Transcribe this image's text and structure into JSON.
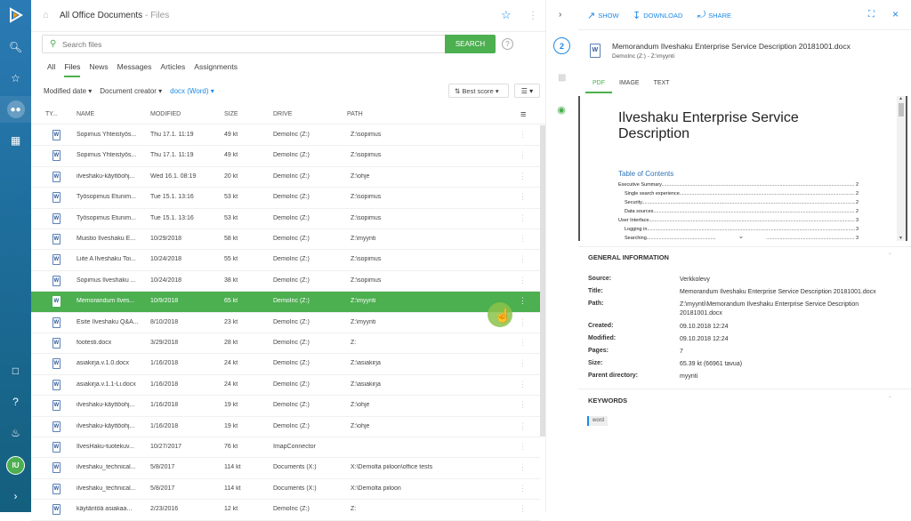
{
  "header": {
    "title": "All Office Documents",
    "subtitle": "- Files"
  },
  "search": {
    "placeholder": "Search files",
    "button": "SEARCH"
  },
  "tabs": [
    "All",
    "Files",
    "News",
    "Messages",
    "Articles",
    "Assignments"
  ],
  "filters": {
    "modified": "Modified date",
    "creator": "Document creator",
    "type": "docx (Word)",
    "sort": "Best score"
  },
  "columns": {
    "type": "TY...",
    "name": "NAME",
    "modified": "MODIFIED",
    "size": "SIZE",
    "drive": "DRIVE",
    "path": "PATH"
  },
  "rows": [
    {
      "name": "Sopimus Yhteistyös...",
      "modified": "Thu 17.1. 11:19",
      "size": "49 kt",
      "drive": "DemoInc (Z:)",
      "path": "Z:\\sopimus"
    },
    {
      "name": "Sopimus Yhteistyös...",
      "modified": "Thu 17.1. 11:19",
      "size": "49 kt",
      "drive": "DemoInc (Z:)",
      "path": "Z:\\sopimus"
    },
    {
      "name": "ilveshaku-käyttöohj...",
      "modified": "Wed 16.1. 08:19",
      "size": "20 kt",
      "drive": "DemoInc (Z:)",
      "path": "Z:\\ohje"
    },
    {
      "name": "Työsopimus Etunim...",
      "modified": "Tue 15.1. 13:16",
      "size": "53 kt",
      "drive": "DemoInc (Z:)",
      "path": "Z:\\sopimus"
    },
    {
      "name": "Työsopimus Etunim...",
      "modified": "Tue 15.1. 13:16",
      "size": "53 kt",
      "drive": "DemoInc (Z:)",
      "path": "Z:\\sopimus"
    },
    {
      "name": "Muistio Ilveshaku E...",
      "modified": "10/29/2018",
      "size": "58 kt",
      "drive": "DemoInc (Z:)",
      "path": "Z:\\myynti"
    },
    {
      "name": "Liite A Ilveshaku Toi...",
      "modified": "10/24/2018",
      "size": "55 kt",
      "drive": "DemoInc (Z:)",
      "path": "Z:\\sopimus"
    },
    {
      "name": "Sopimus Ilveshaku ...",
      "modified": "10/24/2018",
      "size": "38 kt",
      "drive": "DemoInc (Z:)",
      "path": "Z:\\sopimus"
    },
    {
      "name": "Memorandum Ilves...",
      "modified": "10/9/2018",
      "size": "65 kt",
      "drive": "DemoInc (Z:)",
      "path": "Z:\\myynti"
    },
    {
      "name": "Esite Ilveshaku Q&A...",
      "modified": "8/10/2018",
      "size": "23 kt",
      "drive": "DemoInc (Z:)",
      "path": "Z:\\myynti"
    },
    {
      "name": "footesti.docx",
      "modified": "3/29/2018",
      "size": "28 kt",
      "drive": "DemoInc (Z:)",
      "path": "Z:"
    },
    {
      "name": "asiakirja.v.1.0.docx",
      "modified": "1/16/2018",
      "size": "24 kt",
      "drive": "DemoInc (Z:)",
      "path": "Z:\\asiakirja"
    },
    {
      "name": "asiakirja.v.1.1-Li.docx",
      "modified": "1/16/2018",
      "size": "24 kt",
      "drive": "DemoInc (Z:)",
      "path": "Z:\\asiakirja"
    },
    {
      "name": "ilveshaku-käyttöohj...",
      "modified": "1/16/2018",
      "size": "19 kt",
      "drive": "DemoInc (Z:)",
      "path": "Z:\\ohje"
    },
    {
      "name": "ilveshaku-käyttöohj...",
      "modified": "1/16/2018",
      "size": "19 kt",
      "drive": "DemoInc (Z:)",
      "path": "Z:\\ohje"
    },
    {
      "name": "IlvesHaku-tuotekuv...",
      "modified": "10/27/2017",
      "size": "76 kt",
      "drive": "ImapConnector",
      "path": ""
    },
    {
      "name": "ilveshaku_technical...",
      "modified": "5/8/2017",
      "size": "114 kt",
      "drive": "Documents (X:)",
      "path": "X:\\Demolta piiloon\\office tests"
    },
    {
      "name": "ilveshaku_technical...",
      "modified": "5/8/2017",
      "size": "114 kt",
      "drive": "Documents (X:)",
      "path": "X:\\Demolta piiloon"
    },
    {
      "name": "käytäntöä asiakaa...",
      "modified": "2/23/2016",
      "size": "12 kt",
      "drive": "DemoInc (Z:)",
      "path": "Z:"
    }
  ],
  "selected_row": 8,
  "right": {
    "show": "SHOW",
    "download": "DOWNLOAD",
    "share": "SHARE",
    "doc_name": "Memorandum Ilveshaku Enterprise Service Description 20181001.docx",
    "doc_sub": "DemoInc (Z:) - Z:\\myynti",
    "preview_tabs": [
      "PDF",
      "IMAGE",
      "TEXT"
    ],
    "preview_title": "Ilveshaku Enterprise Service Description",
    "toc_title": "Table of Contents",
    "toc": [
      {
        "text": "Executive Summary",
        "page": "2"
      },
      {
        "text": "Single search experience",
        "page": "2"
      },
      {
        "text": "Security",
        "page": "2"
      },
      {
        "text": "Data sources",
        "page": "2"
      },
      {
        "text": "User Interface",
        "page": "3"
      },
      {
        "text": "Logging in",
        "page": "3"
      },
      {
        "text": "Searching",
        "page": "3"
      }
    ],
    "general_title": "GENERAL INFORMATION",
    "info": [
      {
        "label": "Source:",
        "value": "Verkkolevy"
      },
      {
        "label": "Title:",
        "value": "Memorandum Ilveshaku Enterprise Service Description 20181001.docx"
      },
      {
        "label": "Path:",
        "value": "Z:\\myynti\\Memorandum Ilveshaku Enterprise Service Description 20181001.docx"
      },
      {
        "label": "Created:",
        "value": "09.10.2018 12:24"
      },
      {
        "label": "Modified:",
        "value": "09.10.2018 12:24"
      },
      {
        "label": "Pages:",
        "value": "7"
      },
      {
        "label": "Size:",
        "value": "65.39 kt (66961 tavua)"
      },
      {
        "label": "Parent directory:",
        "value": "myynti"
      }
    ],
    "keywords_title": "KEYWORDS",
    "keyword": "word"
  },
  "avatar": "IU",
  "badge": "2"
}
